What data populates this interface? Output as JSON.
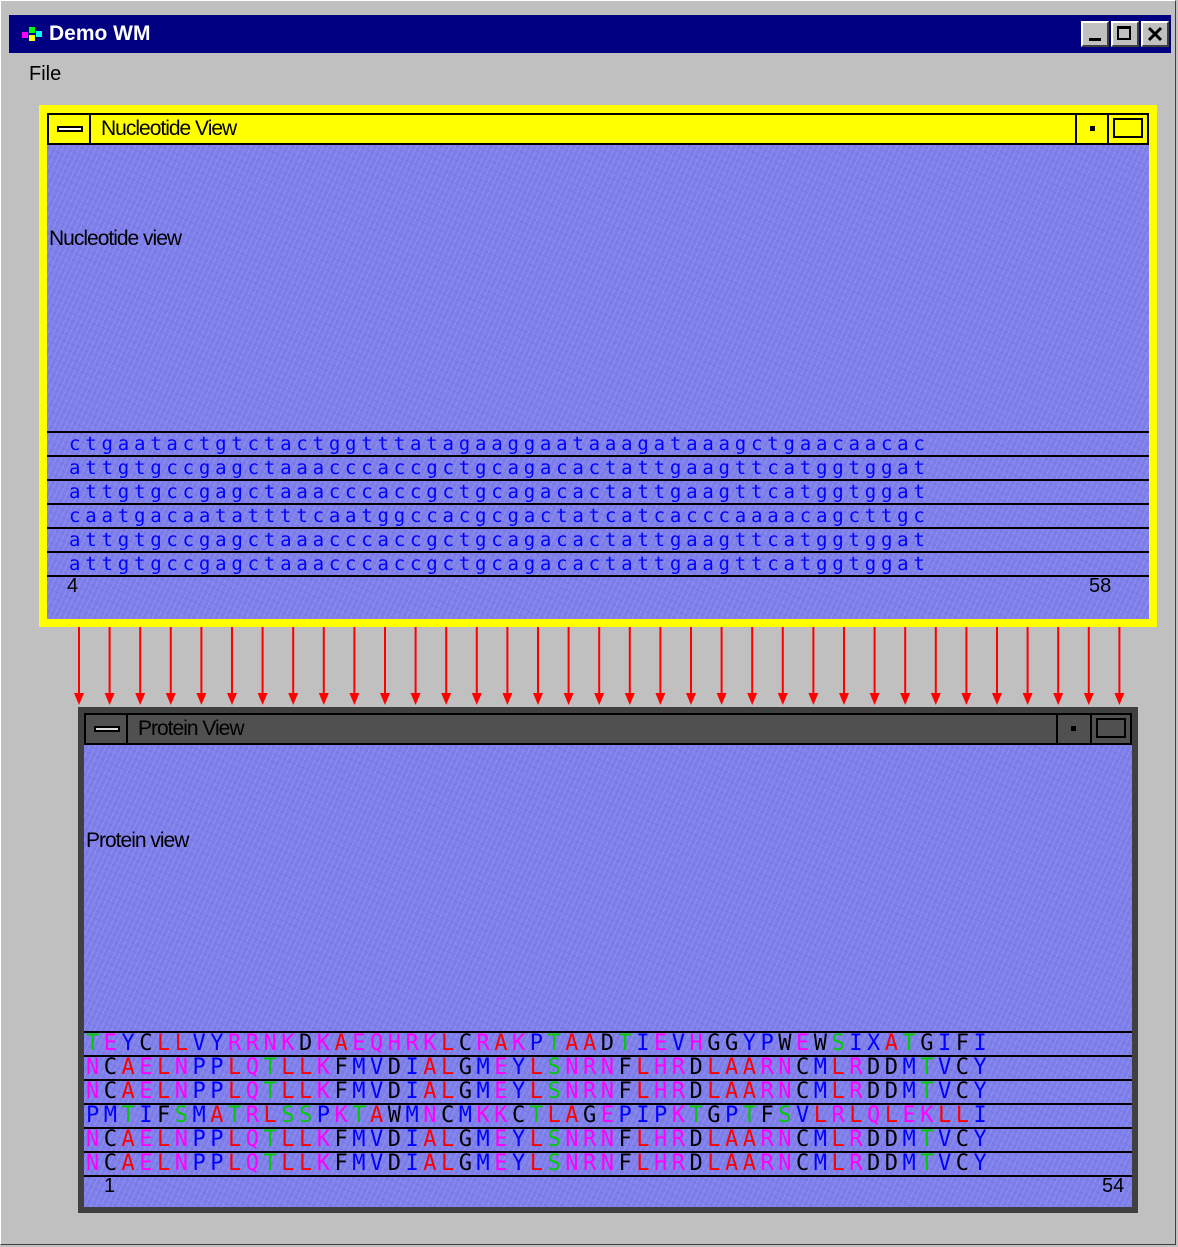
{
  "window": {
    "title": "Demo WM",
    "controls": [
      "minimize",
      "maximize",
      "close"
    ]
  },
  "menu": {
    "file_label": "File"
  },
  "nucleotide": {
    "caption": "Nucleotide View",
    "label": "Nucleotide view",
    "rows": [
      "ctgaatactgtctactggtttatagaaggaataaagataaagctgaacaacac",
      "attgtgccgagctaaacccaccgctgcagacactattgaagttcatggtggat",
      "attgtgccgagctaaacccaccgctgcagacactattgaagttcatggtggat",
      "caatgacaatattttcaatggccacgcgactatcatcacccaaaacagcttgc",
      "attgtgccgagctaaacccaccgctgcagacactattgaagttcatggtggat",
      "attgtgccgagctaaacccaccgctgcagacactattgaagttcatggtggat"
    ],
    "start_pos": "4",
    "end_pos": "58"
  },
  "protein": {
    "caption": "Protein View",
    "label": "Protein view",
    "rows": [
      "TEYCLLVYRRNKDKAEQHRKLCRAKPTAADTIEVHGGYPWEWSIXATGIFI",
      "NCAELNPPLQTLLKFMVDIALGMEYLSNRNFLHRDLAARNCMLRDDMTVCY",
      "NCAELNPPLQTLLKFMVDIALGMEYLSNRNFLHRDLAARNCMLRDDMTVCY",
      "PMTIFSMATRLSSPKTAWMNCMKKCTLAGEPIPKTGPTFSVLRLQLEKLLI",
      "NCAELNPPLQTLLKFMVDIALGMEYLSNRNFLHRDLAARNCMLRDDMTVCY",
      "NCAELNPPLQTLLKFMVDIALGMEYLSNRNFLHRDLAARNCMLRDDMTVCY"
    ],
    "start_pos": "1",
    "end_pos": "54"
  },
  "colors": {
    "nucleotide_text": "#0000ff",
    "arrow": "#ff0000",
    "nucleotide_frame": "#ffff00",
    "protein_frame": "#404040",
    "view_background": "#7f7fea",
    "residue_colors": {
      "pink": "#ff00ff",
      "red": "#ff0000",
      "green": "#00cc00",
      "blue": "#0000ff",
      "black": "#000000"
    }
  }
}
